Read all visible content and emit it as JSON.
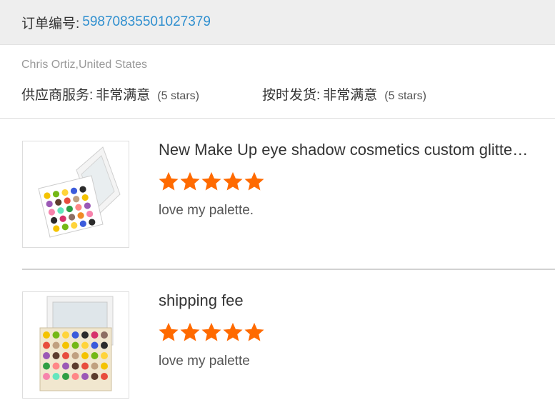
{
  "order": {
    "label": "订单编号:",
    "number": "59870835501027379"
  },
  "buyer": {
    "name": "Chris Ortiz,United States"
  },
  "ratings": {
    "supplier_label": "供应商服务:",
    "supplier_value": "非常满意",
    "supplier_stars": "(5 stars)",
    "delivery_label": "按时发货:",
    "delivery_value": "非常满意",
    "delivery_stars": "(5 stars)"
  },
  "items": [
    {
      "title": "New Make Up eye shadow cosmetics custom glitter eyeshadow palette",
      "stars": 5,
      "comment": "love my palette."
    },
    {
      "title": "shipping fee",
      "stars": 5,
      "comment": "love my palette"
    }
  ],
  "colors": {
    "star": "#ff6a00",
    "order_number": "#2f8fcf"
  },
  "icons": {
    "star": "star-icon"
  }
}
